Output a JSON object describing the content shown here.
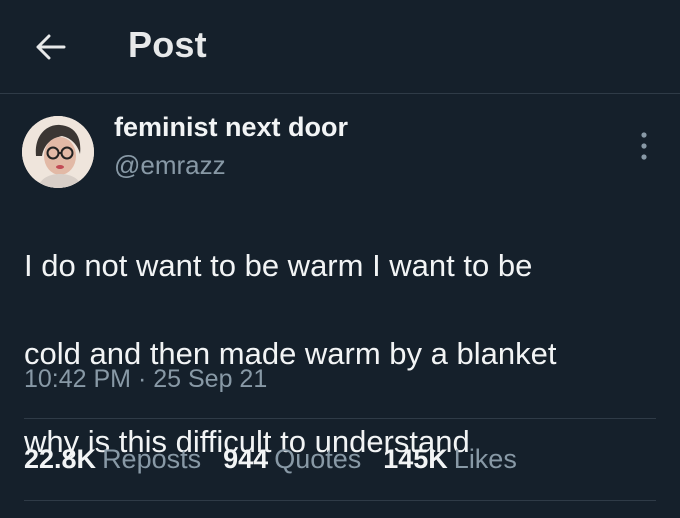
{
  "header": {
    "back_icon": "arrow-left-icon",
    "title": "Post"
  },
  "author": {
    "name": "feminist next door",
    "handle": "@emrazz",
    "avatar_icon": "user-avatar"
  },
  "more_icon": "more-vertical-icon",
  "post": {
    "text_lines": [
      "I do not want to be warm I want to be",
      "cold and then made warm by a blanket",
      "why is this difficult to understand"
    ],
    "time": "10:42 PM",
    "separator": "·",
    "date": "25 Sep 21"
  },
  "stats": {
    "reposts_count": "22.8K",
    "reposts_label": "Reposts",
    "quotes_count": "944",
    "quotes_label": "Quotes",
    "likes_count": "145K",
    "likes_label": "Likes"
  },
  "colors": {
    "background": "#15202b",
    "text_primary": "#f2f4f5",
    "text_secondary": "#8899a6",
    "divider": "#2f3b47"
  }
}
